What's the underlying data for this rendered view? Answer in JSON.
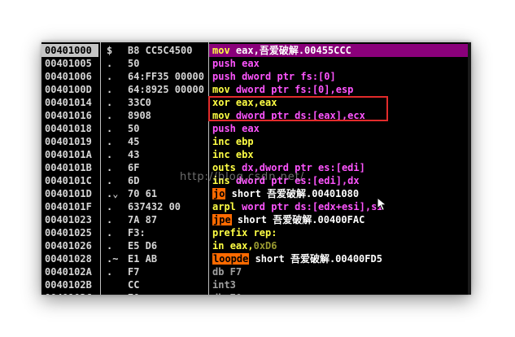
{
  "rows": [
    {
      "addr": "00401000",
      "mark": "$",
      "hex": "B8 CC5C4500",
      "ops": [
        {
          "t": "mov ",
          "c": "c-yel"
        },
        {
          "t": "eax,",
          "c": "c-wht"
        },
        {
          "t": "吾爱破解.00455CCC",
          "c": "c-wht"
        }
      ]
    },
    {
      "addr": "00401005",
      "mark": ".",
      "hex": "50",
      "ops": [
        {
          "t": "push ",
          "c": "c-mag"
        },
        {
          "t": "eax",
          "c": "c-mag"
        }
      ]
    },
    {
      "addr": "00401006",
      "mark": ".",
      "hex": "64:FF35 00000",
      "ops": [
        {
          "t": "push ",
          "c": "c-mag"
        },
        {
          "t": "dword ptr fs:[0]",
          "c": "c-mag"
        }
      ]
    },
    {
      "addr": "0040100D",
      "mark": ".",
      "hex": "64:8925 00000",
      "ops": [
        {
          "t": "mov ",
          "c": "c-yel"
        },
        {
          "t": "dword ptr fs:[0],esp",
          "c": "c-mag"
        }
      ]
    },
    {
      "addr": "00401014",
      "mark": ".",
      "hex": "33C0",
      "ops": [
        {
          "t": "xor ",
          "c": "c-yel"
        },
        {
          "t": "eax,eax",
          "c": "c-yel"
        }
      ]
    },
    {
      "addr": "00401016",
      "mark": ".",
      "hex": "8908",
      "ops": [
        {
          "t": "mov ",
          "c": "c-yel"
        },
        {
          "t": "dword ptr ds:[eax],ecx",
          "c": "c-mag"
        }
      ]
    },
    {
      "addr": "00401018",
      "mark": ".",
      "hex": "50",
      "ops": [
        {
          "t": "push ",
          "c": "c-mag"
        },
        {
          "t": "eax",
          "c": "c-mag"
        }
      ]
    },
    {
      "addr": "00401019",
      "mark": ".",
      "hex": "45",
      "ops": [
        {
          "t": "inc ",
          "c": "c-yel"
        },
        {
          "t": "ebp",
          "c": "c-yel"
        }
      ]
    },
    {
      "addr": "0040101A",
      "mark": ".",
      "hex": "43",
      "ops": [
        {
          "t": "inc ",
          "c": "c-yel"
        },
        {
          "t": "ebx",
          "c": "c-yel"
        }
      ]
    },
    {
      "addr": "0040101B",
      "mark": ".",
      "hex": "6F",
      "ops": [
        {
          "t": "outs ",
          "c": "c-yel"
        },
        {
          "t": "dx,dword ptr es:[edi]",
          "c": "c-mag"
        }
      ]
    },
    {
      "addr": "0040101C",
      "mark": ".",
      "hex": "6D",
      "ops": [
        {
          "t": "ins ",
          "c": "c-yel"
        },
        {
          "t": "dword ptr es:[edi],dx",
          "c": "c-mag"
        }
      ]
    },
    {
      "addr": "0040101D",
      "mark": ".⌄",
      "hex": "70 61",
      "ops": [
        {
          "t": "jo",
          "c": "hl-red"
        },
        {
          "t": " short ",
          "c": "c-wht"
        },
        {
          "t": "吾爱破解.00401080",
          "c": "c-wht"
        }
      ]
    },
    {
      "addr": "0040101F",
      "mark": ".",
      "hex": "637432 00",
      "ops": [
        {
          "t": "arpl ",
          "c": "c-yel"
        },
        {
          "t": "word ptr ds:[edx+esi],si",
          "c": "c-mag"
        }
      ]
    },
    {
      "addr": "00401023",
      "mark": ".",
      "hex": "7A 87",
      "ops": [
        {
          "t": "jpe",
          "c": "hl-red"
        },
        {
          "t": " short ",
          "c": "c-wht"
        },
        {
          "t": "吾爱破解.00400FAC",
          "c": "c-wht"
        }
      ]
    },
    {
      "addr": "00401025",
      "mark": ".",
      "hex": "F3:",
      "ops": [
        {
          "t": "prefix rep:",
          "c": "c-yel"
        }
      ]
    },
    {
      "addr": "00401026",
      "mark": ".",
      "hex": "E5 D6",
      "ops": [
        {
          "t": "in ",
          "c": "c-yel"
        },
        {
          "t": "eax,",
          "c": "c-yel"
        },
        {
          "t": "0xD6",
          "c": "c-olv"
        }
      ]
    },
    {
      "addr": "00401028",
      "mark": ".~",
      "hex": "E1 AB",
      "ops": [
        {
          "t": "loopde",
          "c": "hl-red"
        },
        {
          "t": " short ",
          "c": "c-wht"
        },
        {
          "t": "吾爱破解.00400FD5",
          "c": "c-wht"
        }
      ]
    },
    {
      "addr": "0040102A",
      "mark": ".",
      "hex": "F7",
      "ops": [
        {
          "t": "db F7",
          "c": "c-gry"
        }
      ]
    },
    {
      "addr": "0040102B",
      "mark": "",
      "hex": "CC",
      "ops": [
        {
          "t": "int3",
          "c": "c-gry"
        }
      ]
    },
    {
      "addr": "0040102C",
      "mark": ".",
      "hex": "70",
      "ops": [
        {
          "t": "db 70",
          "c": "c-gry"
        }
      ]
    }
  ],
  "watermark": "http://blog.csdn.net/",
  "colors": {
    "row0_highlight": "#8a007a",
    "box": "#e22b2b",
    "jump_highlight": "#ff6a00"
  },
  "icons": {
    "cursor": "mouse-pointer-icon"
  }
}
